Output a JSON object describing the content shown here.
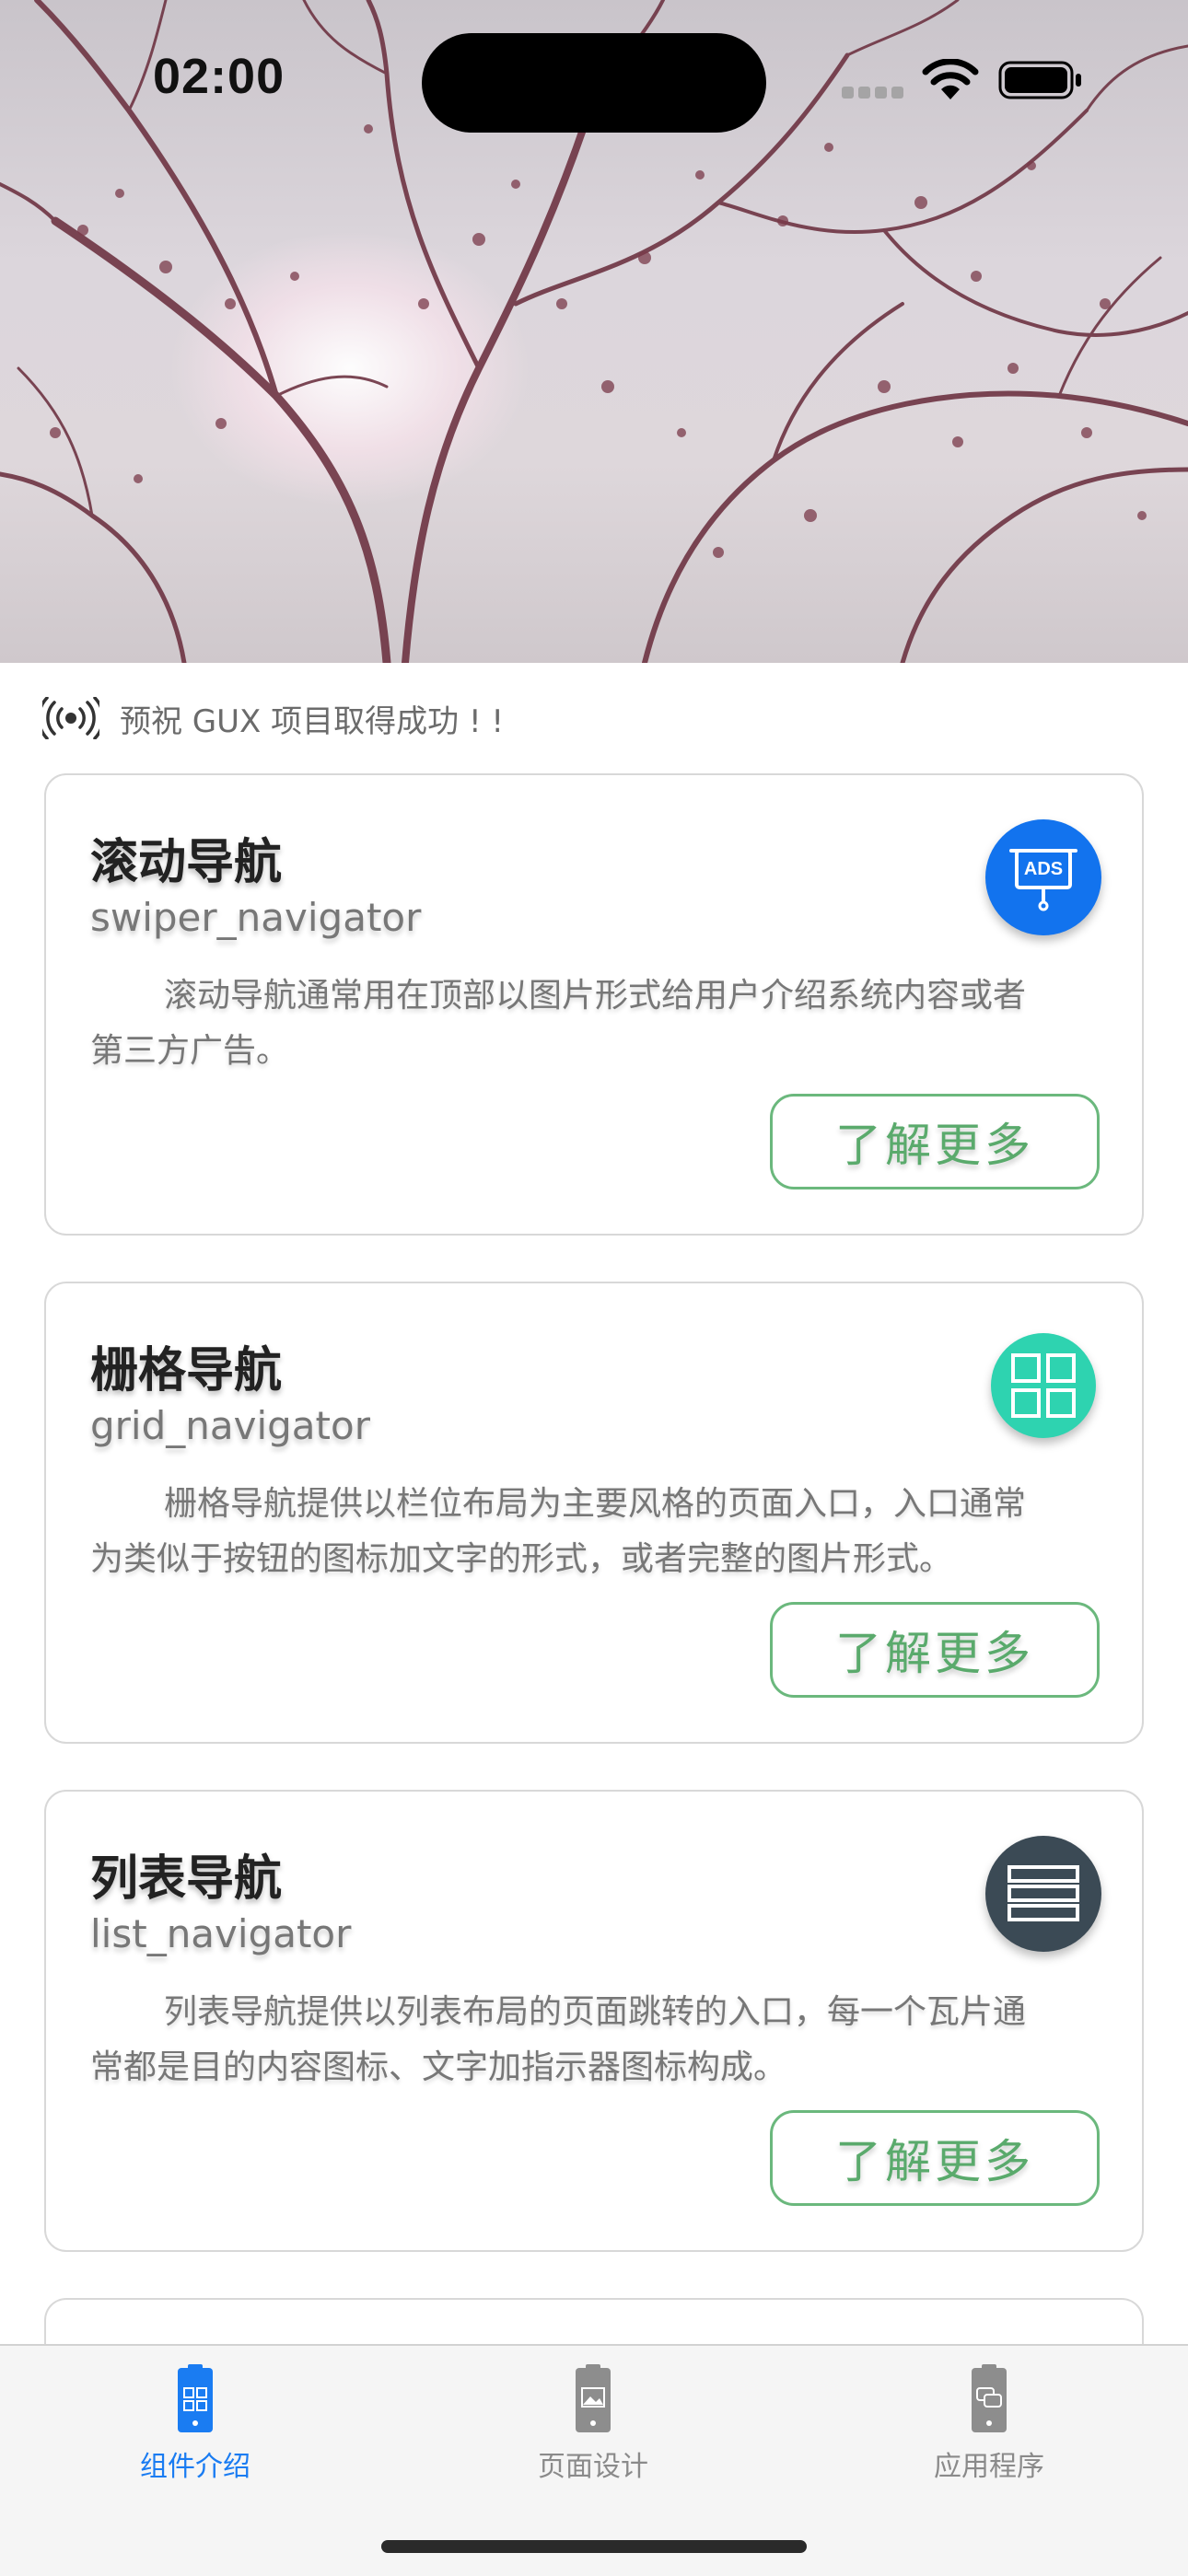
{
  "status_bar": {
    "time": "02:00"
  },
  "notice": {
    "text": "预祝 GUX 项目取得成功 ! !"
  },
  "cards": [
    {
      "title": "滚动导航",
      "subtitle": "swiper_navigator",
      "description": "滚动导航通常用在顶部以图片形式给用户介绍系统内容或者第三方广告。",
      "button": "了解更多",
      "icon": "ads-board-icon",
      "icon_label": "ADS",
      "icon_color": "#1273ee"
    },
    {
      "title": "栅格导航",
      "subtitle": "grid_navigator",
      "description": "栅格导航提供以栏位布局为主要风格的页面入口，入口通常为类似于按钮的图标加文字的形式，或者完整的图片形式。",
      "button": "了解更多",
      "icon": "grid-icon",
      "icon_color": "#2ed3b0"
    },
    {
      "title": "列表导航",
      "subtitle": "list_navigator",
      "description": "列表导航提供以列表布局的页面跳转的入口，每一个瓦片通常都是目的内容图标、文字加指示器图标构成。",
      "button": "了解更多",
      "icon": "list-icon",
      "icon_color": "#3b4a55"
    }
  ],
  "tabbar": {
    "tabs": [
      {
        "label": "组件介绍",
        "icon": "component-phone-icon",
        "active": true
      },
      {
        "label": "页面设计",
        "icon": "page-design-phone-icon",
        "active": false
      },
      {
        "label": "应用程序",
        "icon": "app-phone-icon",
        "active": false
      }
    ]
  },
  "colors": {
    "accent": "#1a7cf2",
    "button_green": "#5aaa6c"
  }
}
